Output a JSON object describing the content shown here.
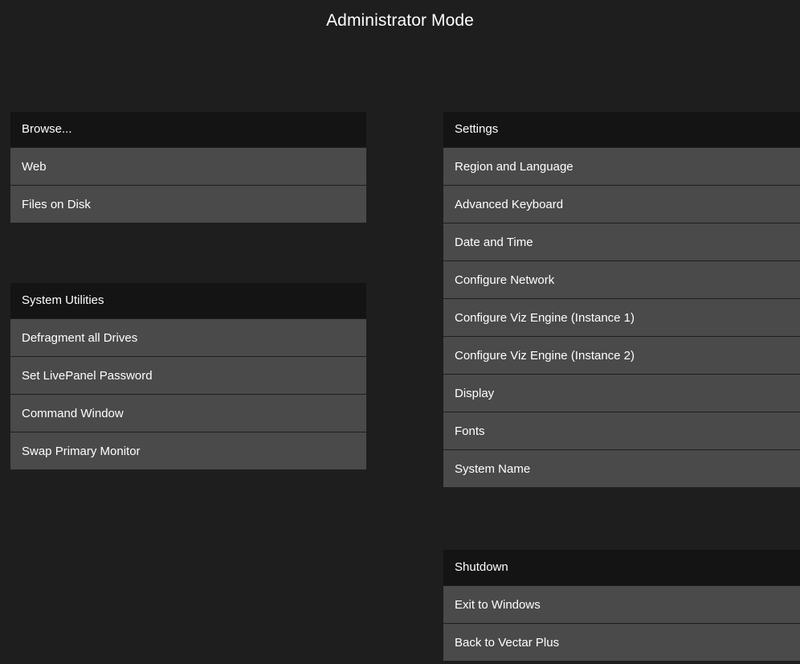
{
  "title": "Administrator Mode",
  "browse": {
    "header": "Browse...",
    "items": [
      "Web",
      "Files on Disk"
    ]
  },
  "utilities": {
    "header": "System Utilities",
    "items": [
      "Defragment all Drives",
      "Set LivePanel Password",
      "Command Window",
      "Swap Primary Monitor"
    ]
  },
  "settings": {
    "header": "Settings",
    "items": [
      "Region and Language",
      "Advanced Keyboard",
      "Date and Time",
      "Configure Network",
      "Configure Viz Engine (Instance 1)",
      "Configure Viz Engine (Instance 2)",
      "Display",
      "Fonts",
      "System Name"
    ]
  },
  "shutdown": {
    "header": "Shutdown",
    "items": [
      "Exit to Windows",
      "Back to Vectar Plus"
    ]
  }
}
